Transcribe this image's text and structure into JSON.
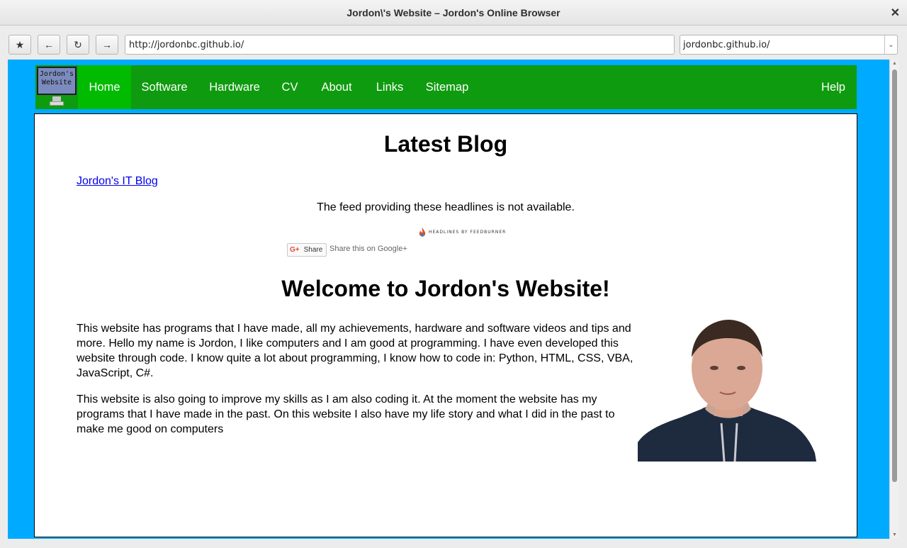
{
  "window": {
    "title": "Jordon\\'s Website – Jordon's Online Browser",
    "close_glyph": "✕"
  },
  "toolbar": {
    "bookmark_glyph": "★",
    "back_glyph": "←",
    "reload_glyph": "↻",
    "forward_glyph": "→",
    "url": "http://jordonbc.github.io/",
    "history_selected": "jordonbc.github.io/",
    "dropdown_glyph": "⌄"
  },
  "site": {
    "logo_text": "Jordon's Website",
    "nav": [
      {
        "label": "Home",
        "active": true
      },
      {
        "label": "Software"
      },
      {
        "label": "Hardware"
      },
      {
        "label": "CV"
      },
      {
        "label": "About"
      },
      {
        "label": "Links"
      },
      {
        "label": "Sitemap"
      }
    ],
    "help_label": "Help"
  },
  "main": {
    "blog_heading": "Latest Blog",
    "blog_link": "Jordon's IT Blog",
    "feed_message": "The feed providing these headlines is not available.",
    "feedburner_badge": "HEADLINES BY FEEDBURNER",
    "share_button": "Share",
    "share_text": "Share this on Google+",
    "welcome_heading": "Welcome to Jordon's Website!",
    "paragraph1": "This website has programs that I have made, all my achievements, hardware and software videos and tips and more. Hello my name is Jordon, I like computers and I am good at programming. I have even developed this website through code. I know quite a lot about programming, I know how to code in: Python, HTML, CSS, VBA, JavaScript, C#.",
    "paragraph2": "This website is also going to improve my skills as I am also coding it. At the moment the website has my programs that I have made in the past. On this website I also have my life story and what I did in the past to make me good on computers"
  },
  "colors": {
    "page_bg": "#00aaff",
    "nav_bg": "#0f9b0f",
    "nav_active": "#00bb00",
    "link": "#0000ee"
  }
}
